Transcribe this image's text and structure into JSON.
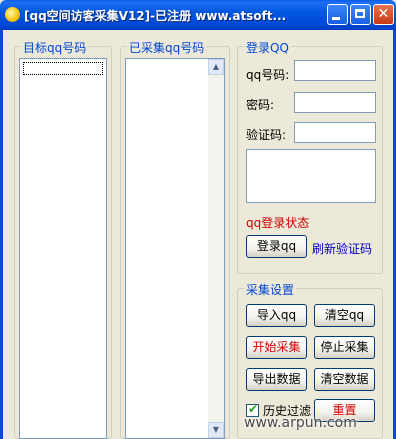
{
  "window": {
    "title": "[qq空间访客采集V12]-已注册 www.atsoft..."
  },
  "target_list": {
    "label": "目标qq号码"
  },
  "collected_list": {
    "label": "已采集qq号码"
  },
  "login": {
    "group_label": "登录QQ",
    "qq_label": "qq号码:",
    "qq_value": "",
    "password_label": "密码:",
    "password_value": "",
    "captcha_label": "验证码:",
    "captcha_value": "",
    "status_text": "qq登录状态",
    "login_button": "登录qq",
    "refresh_link": "刷新验证码"
  },
  "collect": {
    "group_label": "采集设置",
    "import_button": "导入qq",
    "clear_qq_button": "清空qq",
    "start_button": "开始采集",
    "stop_button": "停止采集",
    "export_button": "导出数据",
    "clear_data_button": "清空数据",
    "history_filter_label": "历史过滤",
    "history_filter_checked": true,
    "reset_button": "重置"
  },
  "watermark": "www.arpun.com",
  "colors": {
    "title_bar": "#0054e3",
    "group_label": "#0046d5",
    "status_text": "#d00000",
    "link": "#0000c0"
  }
}
